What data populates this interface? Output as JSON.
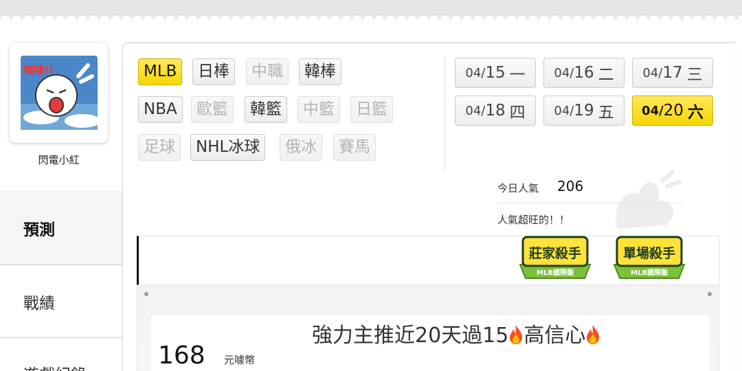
{
  "user": {
    "name": "閃電小紅",
    "avatar_icon": "screaming-character-avatar",
    "avatar_text": "嘿嘿!!"
  },
  "sidebar": {
    "items": [
      {
        "label": "預測",
        "active": true
      },
      {
        "label": "戰績",
        "active": false
      },
      {
        "label": "遊戲紀錄",
        "active": false
      }
    ]
  },
  "sports": [
    {
      "label": "MLB",
      "state": "selected"
    },
    {
      "label": "日棒",
      "state": "normal"
    },
    {
      "label": "中職",
      "state": "disabled"
    },
    {
      "label": "韓棒",
      "state": "normal"
    },
    {
      "label": "NBA",
      "state": "normal"
    },
    {
      "label": "歐籃",
      "state": "disabled"
    },
    {
      "label": "韓籃",
      "state": "normal"
    },
    {
      "label": "中籃",
      "state": "disabled"
    },
    {
      "label": "日籃",
      "state": "disabled"
    },
    {
      "label": "足球",
      "state": "disabled"
    },
    {
      "label": "NHL冰球",
      "state": "normal"
    },
    {
      "label": "俄冰",
      "state": "disabled"
    },
    {
      "label": "賽馬",
      "state": "disabled"
    }
  ],
  "dates": [
    {
      "md": "04/",
      "d": "15",
      "w": "一",
      "selected": false
    },
    {
      "md": "04/",
      "d": "16",
      "w": "二",
      "selected": false
    },
    {
      "md": "04/",
      "d": "17",
      "w": "三",
      "selected": false
    },
    {
      "md": "04/",
      "d": "18",
      "w": "四",
      "selected": false
    },
    {
      "md": "04/",
      "d": "19",
      "w": "五",
      "selected": false
    },
    {
      "md": "04/",
      "d": "20",
      "w": "六",
      "selected": true
    }
  ],
  "popularity": {
    "label": "今日人氣",
    "value": "206",
    "note": "人氣超旺的！！"
  },
  "badges": [
    {
      "title": "莊家殺手",
      "subtitle": "MLB國際盤"
    },
    {
      "title": "單場殺手",
      "subtitle": "MLB國際盤"
    }
  ],
  "prediction": {
    "price": "168",
    "price_unit": "元噱幣",
    "headline": "強力主推近20天過15",
    "headline_suffix": "高信心",
    "icon": "fire-icon"
  },
  "colors": {
    "selected": "#f7d800",
    "badge_green": "#7cc13a",
    "badge_dark": "#1f3d1a"
  }
}
